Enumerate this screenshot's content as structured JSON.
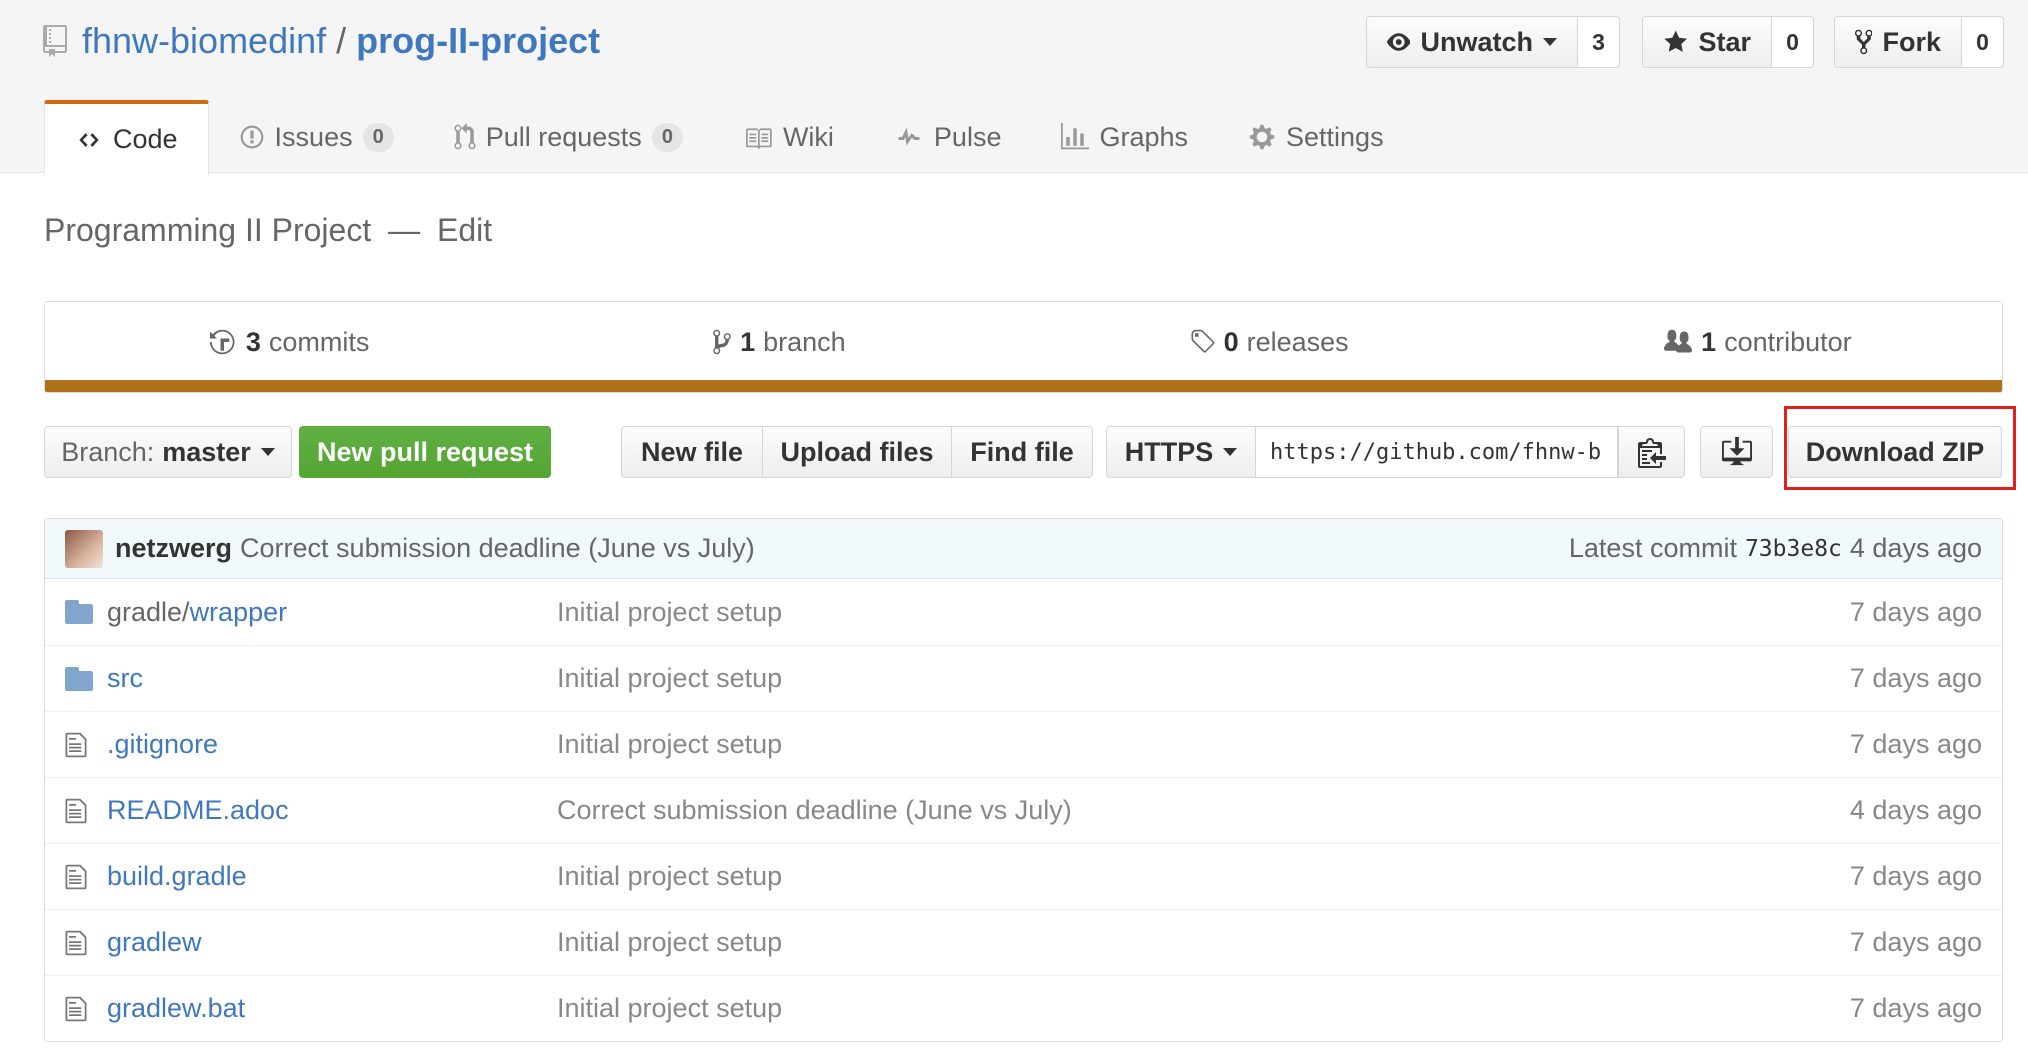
{
  "repo": {
    "owner": "fhnw-biomedinf",
    "separator": "/",
    "name": "prog-II-project"
  },
  "actions": {
    "watch": {
      "label": "Unwatch",
      "count": "3"
    },
    "star": {
      "label": "Star",
      "count": "0"
    },
    "fork": {
      "label": "Fork",
      "count": "0"
    }
  },
  "tabs": [
    {
      "label": "Code",
      "icon": "code-icon",
      "selected": true
    },
    {
      "label": "Issues",
      "icon": "issue-icon",
      "counter": "0"
    },
    {
      "label": "Pull requests",
      "icon": "pull-request-icon",
      "counter": "0"
    },
    {
      "label": "Wiki",
      "icon": "book-icon"
    },
    {
      "label": "Pulse",
      "icon": "pulse-icon"
    },
    {
      "label": "Graphs",
      "icon": "graph-icon"
    },
    {
      "label": "Settings",
      "icon": "gear-icon"
    }
  ],
  "description": {
    "text": "Programming II Project",
    "dash": "—",
    "edit": "Edit"
  },
  "summary": {
    "commits": {
      "count": "3",
      "label": "commits"
    },
    "branches": {
      "count": "1",
      "label": "branch"
    },
    "releases": {
      "count": "0",
      "label": "releases"
    },
    "contributors": {
      "count": "1",
      "label": "contributor"
    },
    "language_color": "#b07219"
  },
  "filenav": {
    "branch_prefix": "Branch:",
    "branch": "master",
    "new_pull_request": "New pull request",
    "new_file": "New file",
    "upload_files": "Upload files",
    "find_file": "Find file",
    "protocol": "HTTPS",
    "clone_url": "https://github.com/fhnw-b",
    "download_zip": "Download ZIP"
  },
  "latest_commit": {
    "author": "netzwerg",
    "message": "Correct submission deadline (June vs July)",
    "prefix": "Latest commit",
    "sha": "73b3e8c",
    "age": "4 days ago"
  },
  "files": [
    {
      "type": "dir",
      "dir_prefix": "gradle/",
      "name": "wrapper",
      "message": "Initial project setup",
      "age": "7 days ago"
    },
    {
      "type": "dir",
      "dir_prefix": "",
      "name": "src",
      "message": "Initial project setup",
      "age": "7 days ago"
    },
    {
      "type": "file",
      "dir_prefix": "",
      "name": ".gitignore",
      "message": "Initial project setup",
      "age": "7 days ago"
    },
    {
      "type": "file",
      "dir_prefix": "",
      "name": "README.adoc",
      "message": "Correct submission deadline (June vs July)",
      "age": "4 days ago"
    },
    {
      "type": "file",
      "dir_prefix": "",
      "name": "build.gradle",
      "message": "Initial project setup",
      "age": "7 days ago"
    },
    {
      "type": "file",
      "dir_prefix": "",
      "name": "gradlew",
      "message": "Initial project setup",
      "age": "7 days ago"
    },
    {
      "type": "file",
      "dir_prefix": "",
      "name": "gradlew.bat",
      "message": "Initial project setup",
      "age": "7 days ago"
    }
  ],
  "colors": {
    "link": "#4078c0",
    "accent_tab": "#d26911",
    "green_button": "#55a532",
    "highlight": "#e02020"
  }
}
